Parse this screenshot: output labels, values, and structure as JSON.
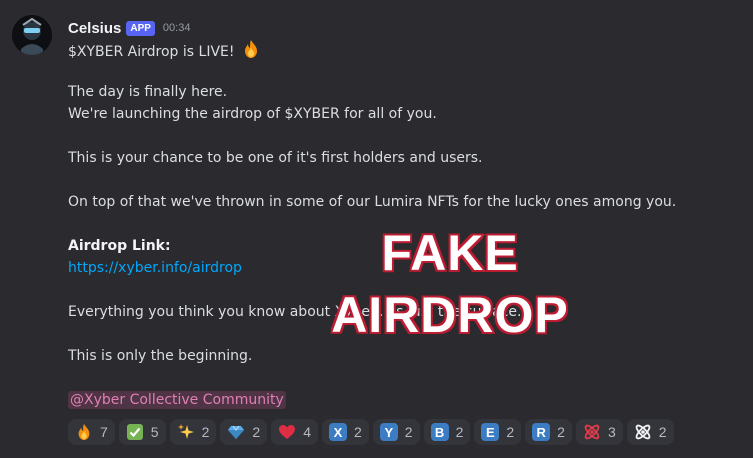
{
  "message": {
    "author": "Celsius",
    "badge": "APP",
    "timestamp": "00:34",
    "title": "$XYBER Airdrop is LIVE!",
    "line1": "The day is finally here.",
    "line2": "We're launching the airdrop of $XYBER for all of you.",
    "line3": "This is your chance to be one of it's first holders and users.",
    "line4": "On top of that we've thrown in some of our Lumira NFTs for the lucky ones among you.",
    "link_label": "Airdrop Link:",
    "link_url": "https://xyber.info/airdrop",
    "line5": "Everything you think you know about Xyber... is just the surface.",
    "line6": "This is only the beginning.",
    "mention": "@Xyber Collective Community"
  },
  "overlay_text": "FAKE AIRDROP",
  "reactions": [
    {
      "emoji": "fire-icon",
      "count": "7"
    },
    {
      "emoji": "check-mark-icon",
      "count": "5"
    },
    {
      "emoji": "sparkles-icon",
      "count": "2"
    },
    {
      "emoji": "gem-icon",
      "count": "2"
    },
    {
      "emoji": "heart-icon",
      "count": "4"
    },
    {
      "emoji": "X",
      "count": "2"
    },
    {
      "emoji": "Y",
      "count": "2"
    },
    {
      "emoji": "B",
      "count": "2"
    },
    {
      "emoji": "E",
      "count": "2"
    },
    {
      "emoji": "R",
      "count": "2"
    },
    {
      "emoji": "red-atom-icon",
      "count": "3"
    },
    {
      "emoji": "white-atom-icon",
      "count": "2"
    }
  ],
  "colors": {
    "background": "#2b2b2f",
    "link": "#00a8fc",
    "badge": "#5865f2",
    "mention": "#e07fb4",
    "overlay_stroke": "#d7263d"
  }
}
